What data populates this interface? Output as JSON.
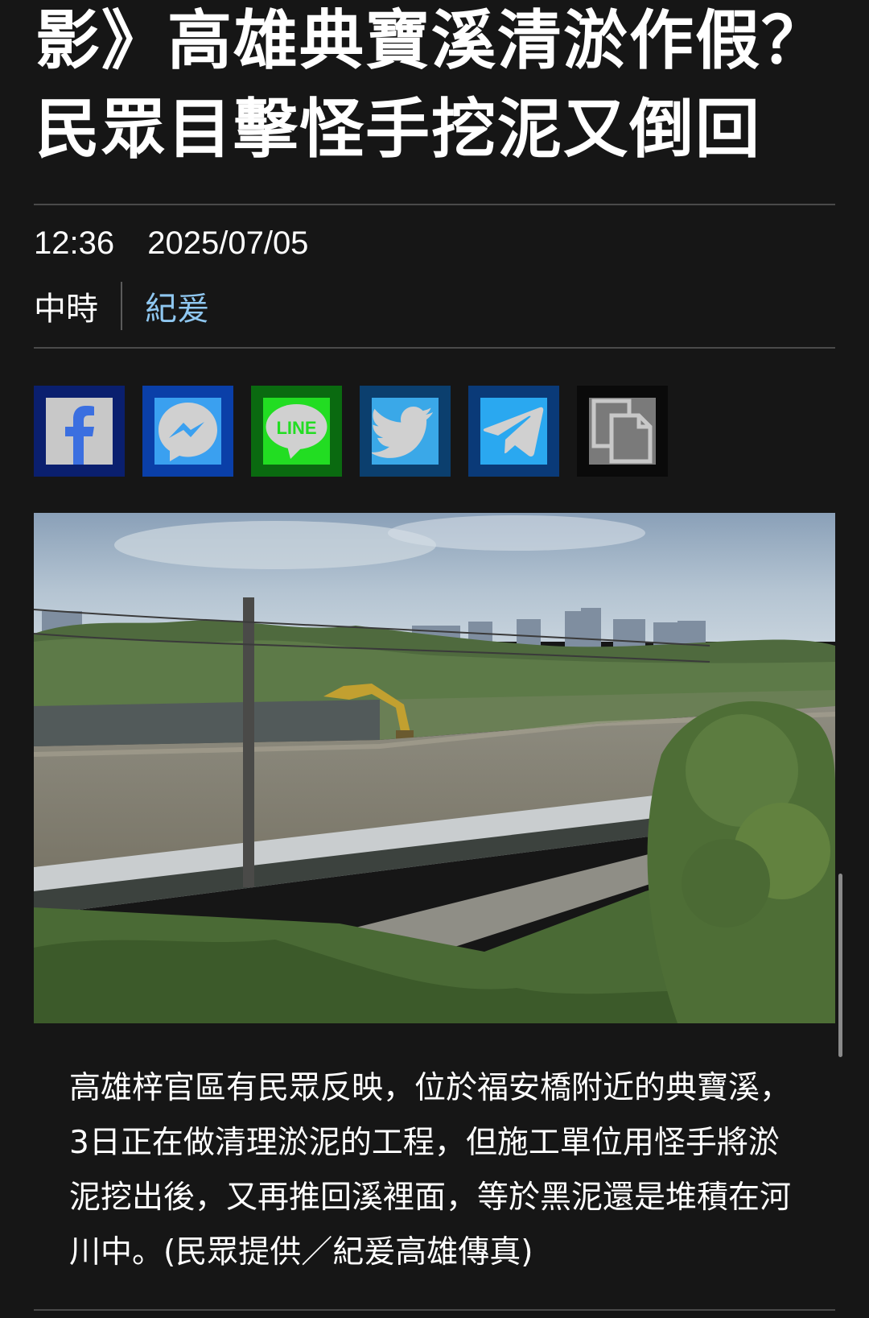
{
  "article": {
    "headline_line1": "影》高雄典寶溪清淤作假？",
    "headline_line2": "民眾目擊怪手挖泥又倒回",
    "time": "12:36",
    "date": "2025/07/05",
    "source": "中時",
    "author": "紀爰"
  },
  "share": {
    "buttons": [
      {
        "name": "facebook",
        "icon": "facebook-icon",
        "bg": "#0a1f6e"
      },
      {
        "name": "messenger",
        "icon": "messenger-icon",
        "bg": "#0a3fa8"
      },
      {
        "name": "line",
        "icon": "line-icon",
        "bg": "#0a6a10",
        "label": "LINE"
      },
      {
        "name": "twitter",
        "icon": "twitter-icon",
        "bg": "#0b3f6e"
      },
      {
        "name": "telegram",
        "icon": "telegram-icon",
        "bg": "#0a3a78"
      },
      {
        "name": "copy",
        "icon": "copy-icon",
        "bg": "#0a0a0a"
      }
    ]
  },
  "photo": {
    "caption": "高雄梓官區有民眾反映，位於福安橋附近的典寶溪，3日正在做清理淤泥的工程，但施工單位用怪手將淤泥挖出後，又再推回溪裡面，等於黑泥還是堆積在河川中。(民眾提供／紀爰高雄傳真)"
  },
  "colors": {
    "background": "#161616",
    "author_link": "#8fc7f0",
    "divider": "#4a4a4a"
  }
}
